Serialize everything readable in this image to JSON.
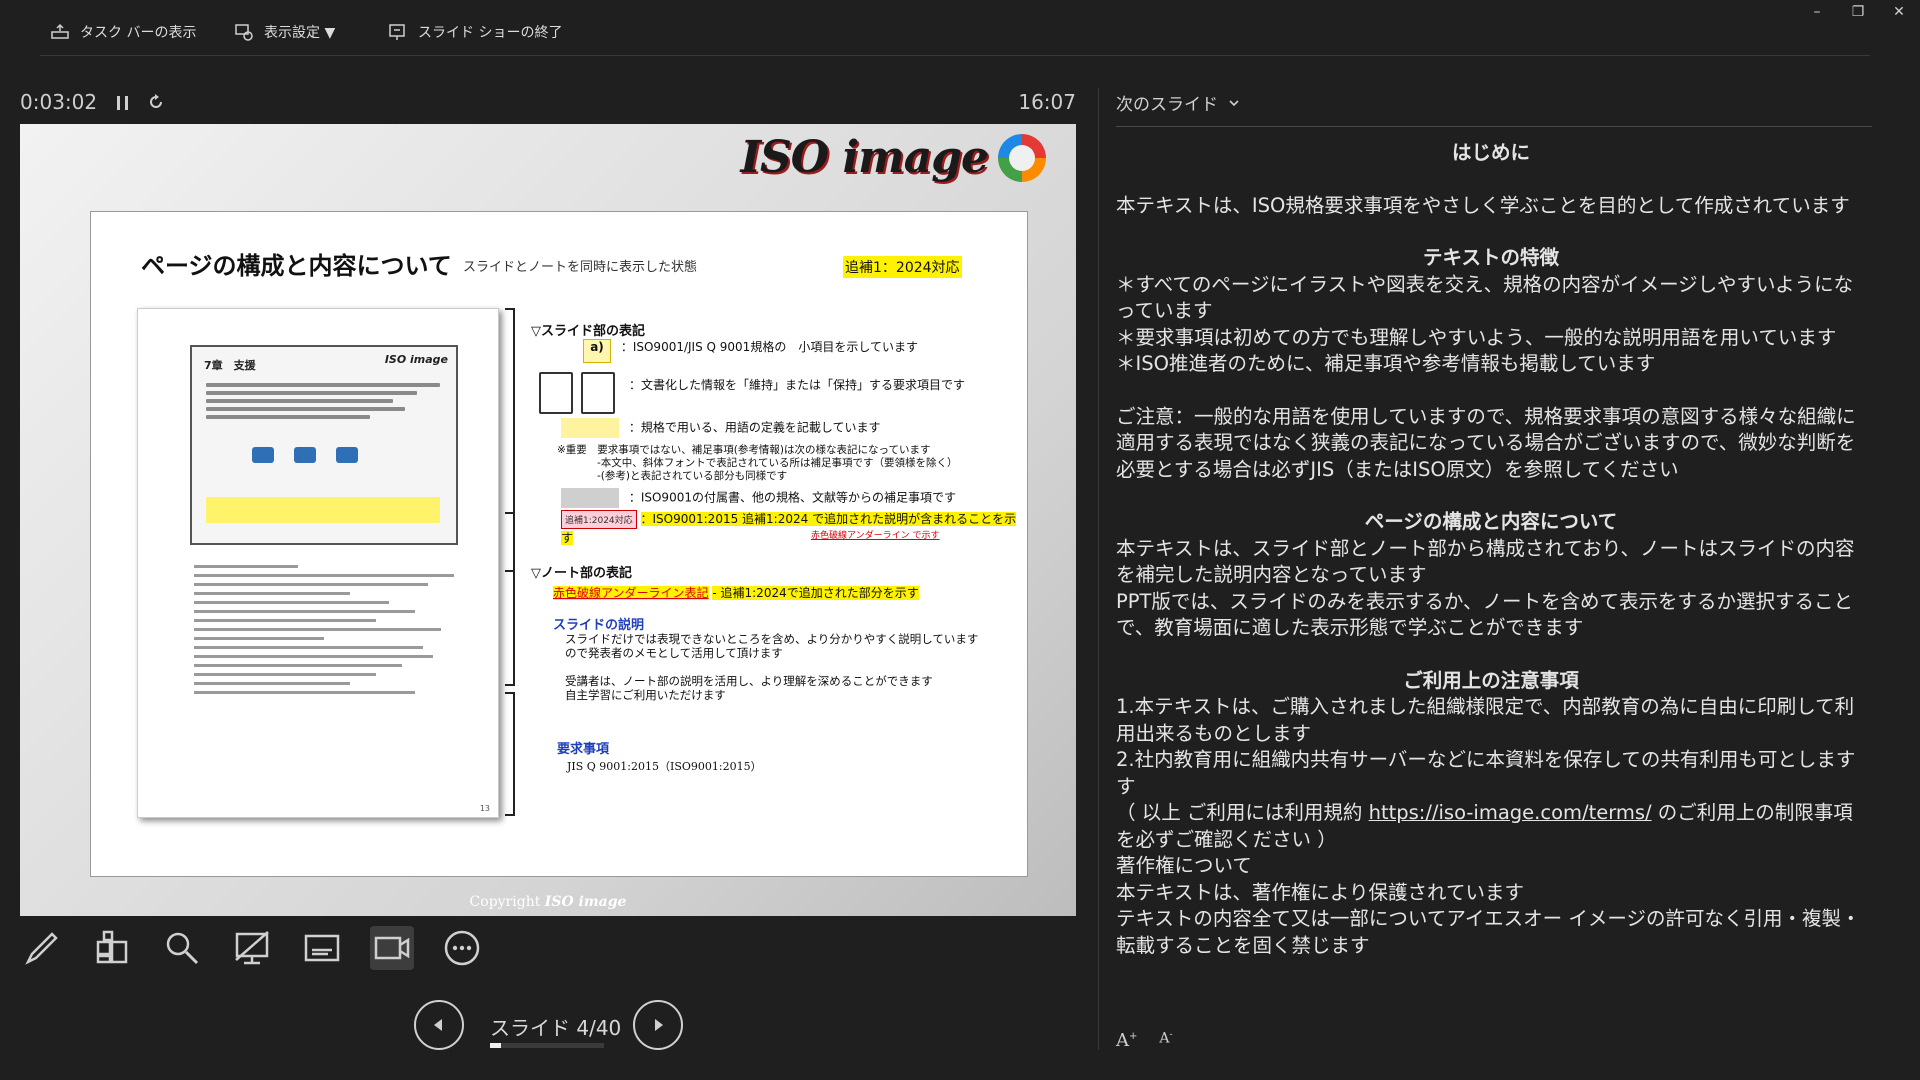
{
  "toolbar": {
    "taskbar_label": "タスク バーの表示",
    "display_settings_label": "表示設定 ▼",
    "end_show_label": "スライド ショーの終了"
  },
  "window": {
    "minimize": "–",
    "restore": "❐",
    "close": "✕"
  },
  "presenter": {
    "elapsed": "0:03:02",
    "clock": "16:07",
    "slide_counter": "スライド 4/40",
    "progress": 0.1
  },
  "slide": {
    "logo_text": "ISO image",
    "title": "ページの構成と内容について",
    "subtitle": "スライドとノートを同時に表示した状態",
    "tag": "追補1：2024対応",
    "thumb": {
      "chapter": "7章　支援",
      "logo": "ISO image"
    },
    "legend": {
      "slide_head": "▽スライド部の表記",
      "badge": "a)",
      "item_a": "：ISO9001/JIS Q 9001規格の　小項目を示しています",
      "item_doc": "：文書化した情報を「維持」または「保持」する要求項目です",
      "item_term": "：規格で用いる、用語の定義を記載しています",
      "note1": "※重要　要求事項ではない、補足事項(参考情報)は次の様な表記になっています",
      "note2": "-本文中、斜体フォントで表記されている所は補足事項です（要領様を除く）",
      "note3": "-(参考)と表記されている部分も同様です",
      "item_annex": "：ISO9001の付属書、他の規格、文献等からの補足事項です",
      "item_add": "：ISO9001:2015 追補1:2024 で追加された説明が含まれることを示す",
      "item_add_badge": "追補1:2024対応",
      "item_add_note": "赤色破線アンダーライン で示す",
      "note_head": "▽ノート部の表記",
      "note_red": "赤色破線アンダーライン表記",
      "note_red_desc": "- 追補1:2024で追加された部分を示す",
      "expl_head": "スライドの説明",
      "expl1": "スライドだけでは表現できないところを含め、より分かりやすく説明しています",
      "expl2": "ので発表者のメモとして活用して頂けます",
      "expl3": "受講者は、ノート部の説明を活用し、より理解を深めることができます",
      "expl4": "自主学習にご利用いただけます",
      "req_head": "要求事項",
      "req_text": "JIS Q 9001:2015（ISO9001:2015）"
    },
    "copyright_prefix": "Copyright",
    "copyright_brand": "ISO image"
  },
  "notes_pane": {
    "next_slide_label": "次のスライド",
    "h1": "はじめに",
    "p1": "本テキストは、ISO規格要求事項をやさしく学ぶことを目的として作成されています",
    "h2": "テキストの特徴",
    "f1": "＊すべてのページにイラストや図表を交え、規格の内容がイメージしやすいようになっています",
    "f2": "＊要求事項は初めての方でも理解しやすいよう、一般的な説明用語を用いています",
    "f3": "＊ISO推進者のために、補足事項や参考情報も掲載しています",
    "caution": "ご注意：一般的な用語を使用していますので、規格要求事項の意図する様々な組織に適用する表現ではなく狭義の表記になっている場合がございますので、微妙な判断を必要とする場合は必ずJIS（またはISO原文）を参照してください",
    "h3": "ページの構成と内容について",
    "p3a": "本テキストは、スライド部とノート部から構成されており、ノートはスライドの内容を補完した説明内容となっています",
    "p3b": "PPT版では、スライドのみを表示するか、ノートを含めて表示をするか選択することで、教育場面に適した表示形態で学ぶことができます",
    "h4": "ご利用上の注意事項",
    "u1": "1.本テキストは、ご購入されました組織様限定で、内部教育の為に自由に印刷して利用出来るものとします",
    "u2": "2.社内教育用に組織内共有サーバーなどに本資料を保存しての共有利用も可としますす",
    "u3_prefix": "（ 以上 ご利用には利用規約 ",
    "u3_link": "https://iso-image.com/terms/",
    "u3_suffix": " のご利用上の制限事項を必ずご確認ください ）",
    "c1": "著作権について",
    "c2": "本テキストは、著作権により保護されています",
    "c3": "テキストの内容全て又は一部についてアイエスオー イメージの許可なく引用・複製・転載することを固く禁じます"
  }
}
